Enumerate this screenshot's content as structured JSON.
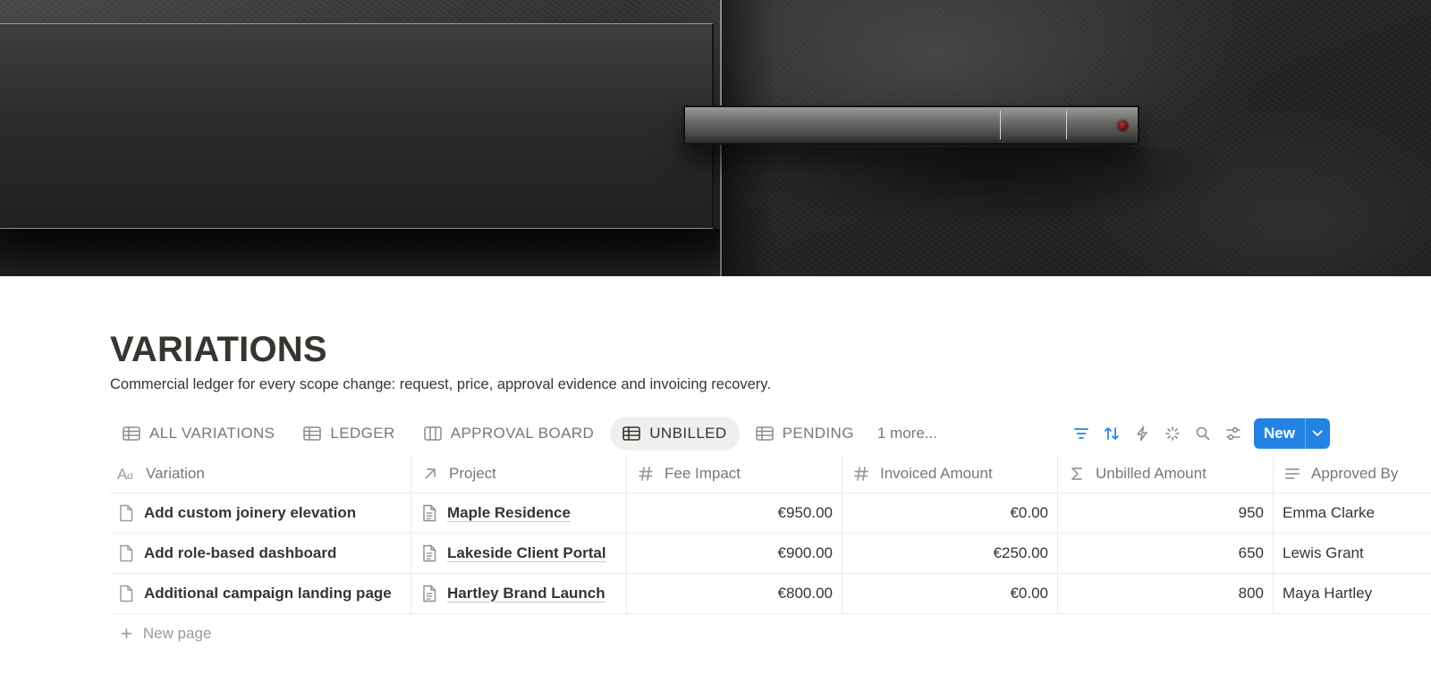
{
  "page": {
    "title": "VARIATIONS",
    "description": "Commercial ledger for every scope change: request, price, approval evidence and invoicing recovery."
  },
  "views": {
    "tabs": [
      {
        "label": "ALL VARIATIONS",
        "icon": "table-icon",
        "active": false
      },
      {
        "label": "LEDGER",
        "icon": "table-icon",
        "active": false
      },
      {
        "label": "APPROVAL BOARD",
        "icon": "board-icon",
        "active": false
      },
      {
        "label": "UNBILLED",
        "icon": "table-icon",
        "active": true
      },
      {
        "label": "PENDING",
        "icon": "table-icon",
        "active": false
      }
    ],
    "more_label": "1 more..."
  },
  "toolbar": {
    "icons": [
      "filter-icon",
      "sort-icon",
      "automation-lightning-icon",
      "ai-sparkle-icon",
      "search-icon",
      "settings-sliders-icon"
    ],
    "accent": "#2383e2",
    "new_label": "New"
  },
  "table": {
    "columns": [
      {
        "label": "Variation",
        "icon": "title-aa-icon"
      },
      {
        "label": "Project",
        "icon": "relation-arrow-icon"
      },
      {
        "label": "Fee Impact",
        "icon": "number-hash-icon"
      },
      {
        "label": "Invoiced Amount",
        "icon": "number-hash-icon"
      },
      {
        "label": "Unbilled Amount",
        "icon": "formula-sigma-icon"
      },
      {
        "label": "Approved By",
        "icon": "text-lines-icon"
      }
    ],
    "rows": [
      {
        "variation": "Add custom joinery elevation",
        "project": "Maple Residence",
        "fee_impact": "€950.00",
        "invoiced": "€0.00",
        "unbilled": "950",
        "approved_by": "Emma Clarke"
      },
      {
        "variation": "Add role-based dashboard",
        "project": "Lakeside Client Portal",
        "fee_impact": "€900.00",
        "invoiced": "€250.00",
        "unbilled": "650",
        "approved_by": "Lewis Grant"
      },
      {
        "variation": "Additional campaign landing page",
        "project": "Hartley Brand Launch",
        "fee_impact": "€800.00",
        "invoiced": "€0.00",
        "unbilled": "800",
        "approved_by": "Maya Hartley"
      }
    ],
    "new_page_label": "New page"
  }
}
